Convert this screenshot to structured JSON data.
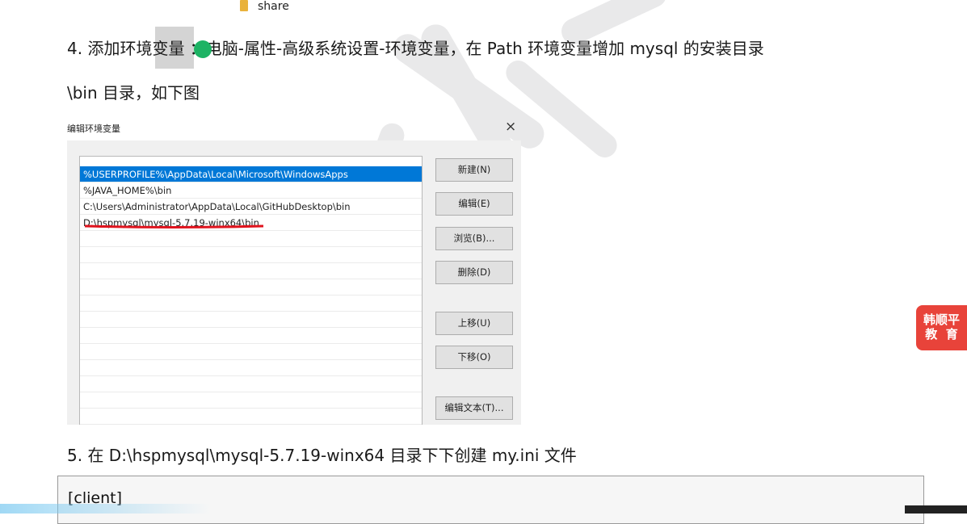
{
  "top": {
    "share_label": "share"
  },
  "step4": {
    "line1": "4.  添加环境变量 ：电脑-属性-高级系统设置-环境变量，在 Path  环境变量增加 mysql 的安装目录",
    "line2": "\\bin 目录，如下图"
  },
  "dialog": {
    "title": "编辑环境变量",
    "close_glyph": "×",
    "paths": [
      "%USERPROFILE%\\AppData\\Local\\Microsoft\\WindowsApps",
      "%JAVA_HOME%\\bin",
      "C:\\Users\\Administrator\\AppData\\Local\\GitHubDesktop\\bin",
      "D:\\hspmysql\\mysql-5.7.19-winx64\\bin"
    ],
    "selected_index": 0,
    "buttons": {
      "new": "新建(N)",
      "edit": "编辑(E)",
      "browse": "浏览(B)...",
      "delete": "删除(D)",
      "move_up": "上移(U)",
      "move_down": "下移(O)",
      "edit_text": "编辑文本(T)..."
    },
    "colors": {
      "selection": "#0078d7",
      "underline": "#e0141e"
    }
  },
  "badge": {
    "line1": "韩顺平",
    "line2": "教  育",
    "color": "#e8433a"
  },
  "step5": {
    "text": "5.  在 D:\\hspmysql\\mysql-5.7.19-winx64  目录下下创建  my.ini  文件"
  },
  "code": {
    "first_line": "[client]"
  },
  "icons": {
    "folder": "folder-icon",
    "close": "close-icon"
  }
}
